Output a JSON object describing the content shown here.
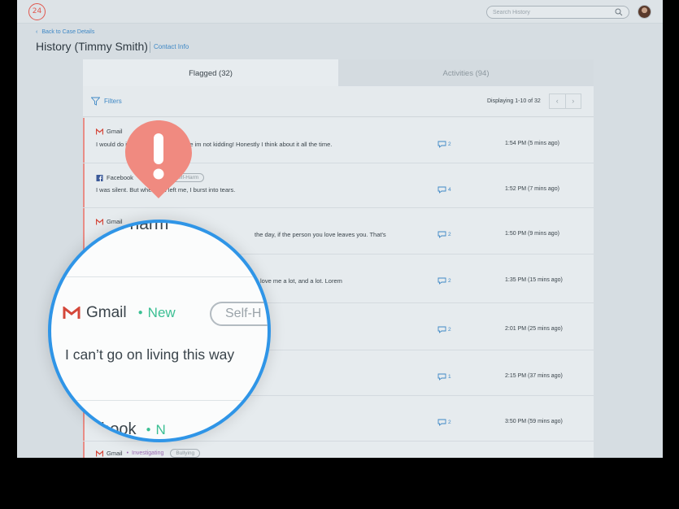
{
  "app": {
    "logo_text": "24",
    "search_placeholder": "Search History",
    "search_icon": "search-icon",
    "avatar_icon": "avatar"
  },
  "header": {
    "back_label": "Back to Case Details",
    "title": "History (Timmy Smith)",
    "contact_label": "Contact Info"
  },
  "tabs": [
    {
      "label": "Flagged (32)",
      "active": true
    },
    {
      "label": "Activities (94)",
      "active": false
    }
  ],
  "toolbar": {
    "filters_label": "Filters",
    "displaying": "Displaying 1-10  of 32",
    "prev": "‹",
    "next": "›"
  },
  "rows": [
    {
      "source": "Gmail",
      "status": "",
      "tag": "",
      "message": "I would do it anyway, but the suicide im not kidding! Honestly I think about it all the time.",
      "count": "2",
      "time": "1:54 PM (5 mins ago)"
    },
    {
      "source": "Facebook",
      "status": "",
      "tag": "Self-Harm",
      "message": "I was silent. But when you left me, I burst into tears.",
      "count": "4",
      "time": "1:52 PM (7 mins ago)"
    },
    {
      "source": "Gmail",
      "status": "",
      "tag": "",
      "message": "the day, if the person you love leaves you. That's",
      "count": "2",
      "time": "1:50 PM (9 mins ago)"
    },
    {
      "source": "",
      "status": "",
      "tag": "",
      "message": "love me a lot, and a lot. Lorem",
      "count": "2",
      "time": "1:35 PM (15 mins ago)"
    },
    {
      "source": "",
      "status": "",
      "tag": "",
      "message": "",
      "count": "2",
      "time": "2:01 PM (25 mins ago)"
    },
    {
      "source": "",
      "status": "",
      "tag": "",
      "message": "",
      "count": "1",
      "time": "2:15 PM (37 mins ago)"
    },
    {
      "source": "",
      "status": "",
      "tag": "",
      "message": "",
      "count": "2",
      "time": "3:50 PM (59 mins ago)"
    },
    {
      "source": "Gmail",
      "status": "Investigating",
      "tag": "Bullying",
      "message": "",
      "count": "",
      "time": ""
    }
  ],
  "magnifier": {
    "top_text": "self harm",
    "source": "Gmail",
    "status": "New",
    "tag": "Self-H",
    "message": "I can’t go on living this way",
    "bottom_source": "ebook",
    "bottom_status": "N"
  },
  "colors": {
    "accent_blue": "#3f88c5",
    "flag_red": "#e98d86",
    "new_green": "#3bbf93",
    "investigating_purple": "#9b6ab3",
    "alert_pin": "#f08a80",
    "magnifier_border": "#2f95e7"
  }
}
